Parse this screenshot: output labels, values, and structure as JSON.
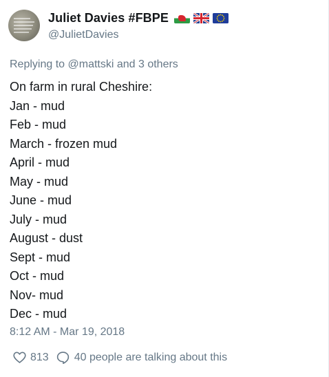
{
  "author": {
    "display_name": "Juliet Davies #FBPE",
    "handle": "@JulietDavies"
  },
  "flags": [
    "wales-flag-icon",
    "uk-flag-icon",
    "eu-flag-icon"
  ],
  "reply_context": "Replying to @mattski and 3 others",
  "tweet_lines": [
    "On farm in rural Cheshire:",
    "Jan - mud",
    "Feb - mud",
    "March - frozen mud",
    "April - mud",
    "May - mud",
    "June - mud",
    "July - mud",
    "August - dust",
    "Sept - mud",
    "Oct - mud",
    "Nov- mud",
    "Dec - mud"
  ],
  "timestamp": "8:12 AM - Mar 19, 2018",
  "stats": {
    "likes": "813",
    "talking": "40 people are talking about this"
  },
  "colors": {
    "text": "#14171a",
    "secondary": "#657786"
  }
}
